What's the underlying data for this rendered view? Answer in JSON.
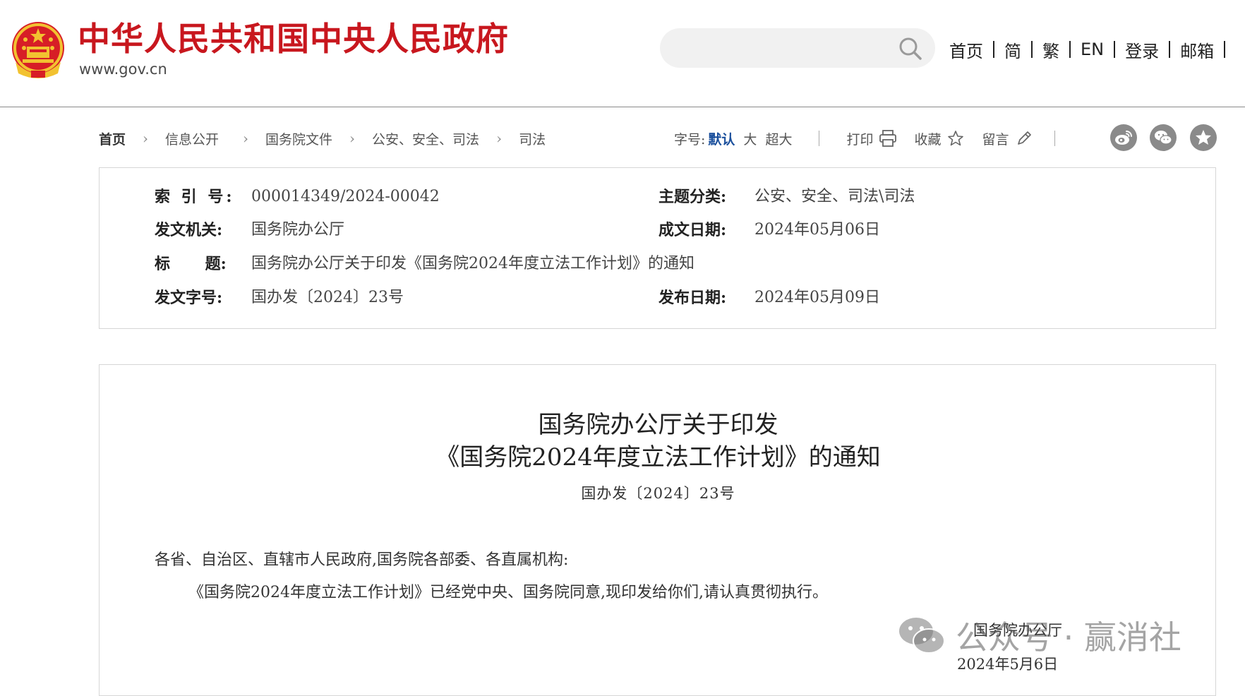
{
  "header": {
    "site_title": "中华人民共和国中央人民政府",
    "site_url": "www.gov.cn",
    "search": {
      "placeholder": ""
    },
    "nav": [
      "首页",
      "简",
      "繁",
      "EN",
      "登录",
      "邮箱"
    ]
  },
  "breadcrumb": [
    "首页",
    "信息公开",
    "国务院文件",
    "公安、安全、司法",
    "司法"
  ],
  "toolbar": {
    "font_size_label": "字号:",
    "sizes": [
      "默认",
      "大",
      "超大"
    ],
    "active_size": "默认",
    "print": "打印",
    "favorite": "收藏",
    "comment": "留言",
    "share_icons": [
      "weibo-icon",
      "wechat-icon",
      "qzone-star-icon"
    ]
  },
  "info": {
    "index_label": "索 引 号:",
    "index_value": "000014349/2024-00042",
    "category_label": "主题分类:",
    "category_value": "公安、安全、司法\\司法",
    "issuer_label": "发文机关:",
    "issuer_value": "国务院办公厅",
    "created_label": "成文日期:",
    "created_value": "2024年05月06日",
    "title_label": "标 题:",
    "title_value": "国务院办公厅关于印发《国务院2024年度立法工作计划》的通知",
    "docnum_label": "发文字号:",
    "docnum_value": "国办发〔2024〕23号",
    "published_label": "发布日期:",
    "published_value": "2024年05月09日"
  },
  "document": {
    "title_line1": "国务院办公厅关于印发",
    "title_line2": "《国务院2024年度立法工作计划》的通知",
    "doc_number": "国办发〔2024〕23号",
    "salutation": "各省、自治区、直辖市人民政府,国务院各部委、各直属机构:",
    "body": "《国务院2024年度立法工作计划》已经党中央、国务院同意,现印发给你们,请认真贯彻执行。",
    "signature": "国务院办公厅",
    "date": "2024年5月6日"
  },
  "watermark": {
    "text": "公众号 · 赢消社"
  },
  "colors": {
    "brand_red": "#c8171e",
    "active_blue": "#1a4f9c",
    "icon_gray": "#8a8a8a"
  }
}
